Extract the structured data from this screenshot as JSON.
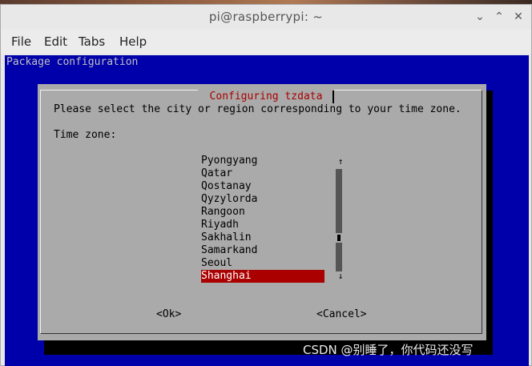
{
  "window": {
    "title": "pi@raspberrypi: ~",
    "controls": {
      "minimize": "⌄",
      "maximize": "⌃",
      "close": "✕"
    }
  },
  "menubar": {
    "items": [
      {
        "label": "File"
      },
      {
        "label": "Edit"
      },
      {
        "label": "Tabs"
      },
      {
        "label": "Help"
      }
    ]
  },
  "terminal": {
    "package_title": "Package configuration",
    "dialog": {
      "title": " Configuring tzdata ",
      "prompt": "Please select the city or region corresponding to your time zone.",
      "field_label": "Time zone:",
      "options": [
        {
          "label": "Pyongyang",
          "selected": false
        },
        {
          "label": "Qatar",
          "selected": false
        },
        {
          "label": "Qostanay",
          "selected": false
        },
        {
          "label": "Qyzylorda",
          "selected": false
        },
        {
          "label": "Rangoon",
          "selected": false
        },
        {
          "label": "Riyadh",
          "selected": false
        },
        {
          "label": "Sakhalin",
          "selected": false
        },
        {
          "label": "Samarkand",
          "selected": false
        },
        {
          "label": "Seoul",
          "selected": false
        },
        {
          "label": "Shanghai",
          "selected": true
        }
      ],
      "scroll_up": "↑",
      "scroll_down": "↓",
      "ok_label": "<Ok>",
      "cancel_label": "<Cancel>"
    }
  },
  "watermark": "CSDN @别睡了，你代码还没写",
  "colors": {
    "terminal_bg": "#0000aa",
    "dialog_bg": "#aaaaaa",
    "title_red": "#aa0000",
    "selection_bg": "#aa0000",
    "selection_fg": "#ffffff"
  }
}
